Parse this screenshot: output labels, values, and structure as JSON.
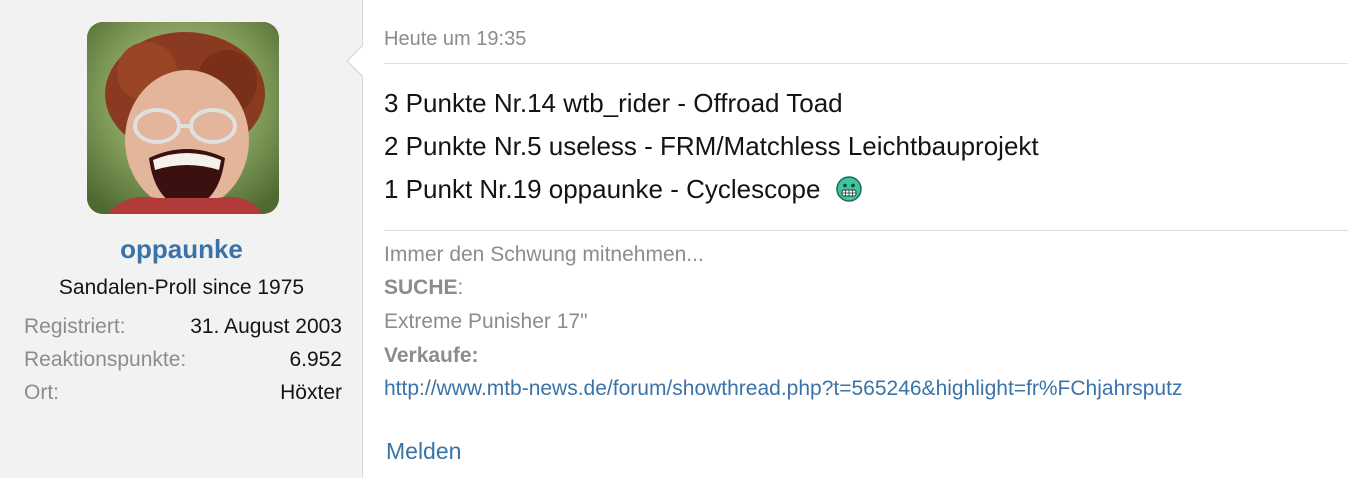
{
  "user": {
    "name": "oppaunke",
    "title": "Sandalen-Proll since 1975",
    "info": [
      {
        "key": "Registriert:",
        "value": "31. August 2003"
      },
      {
        "key": "Reaktionspunkte:",
        "value": "6.952"
      },
      {
        "key": "Ort:",
        "value": "Höxter"
      }
    ]
  },
  "post": {
    "date": "Heute um 19:35",
    "lines": [
      "3 Punkte Nr.14 wtb_rider - Offroad Toad",
      "2 Punkte Nr.5 useless - FRM/Matchless Leichtbauprojekt",
      "1 Punkt Nr.19 oppaunke - Cyclescope"
    ],
    "smiley_icon": "grin-smiley-icon"
  },
  "signature": {
    "line1": "Immer den Schwung mitnehmen...",
    "search_label": "SUCHE",
    "search_colon": ":",
    "search_item": "Extreme Punisher 17\"",
    "sale_label": "Verkaufe:",
    "sale_link": "http://www.mtb-news.de/forum/showthread.php?t=565246&highlight=fr%FChjahrsputz"
  },
  "actions": {
    "report": "Melden"
  },
  "colors": {
    "link": "#3a73a8",
    "muted": "#8c8c8c",
    "sidebar_bg": "#f2f2f2"
  }
}
